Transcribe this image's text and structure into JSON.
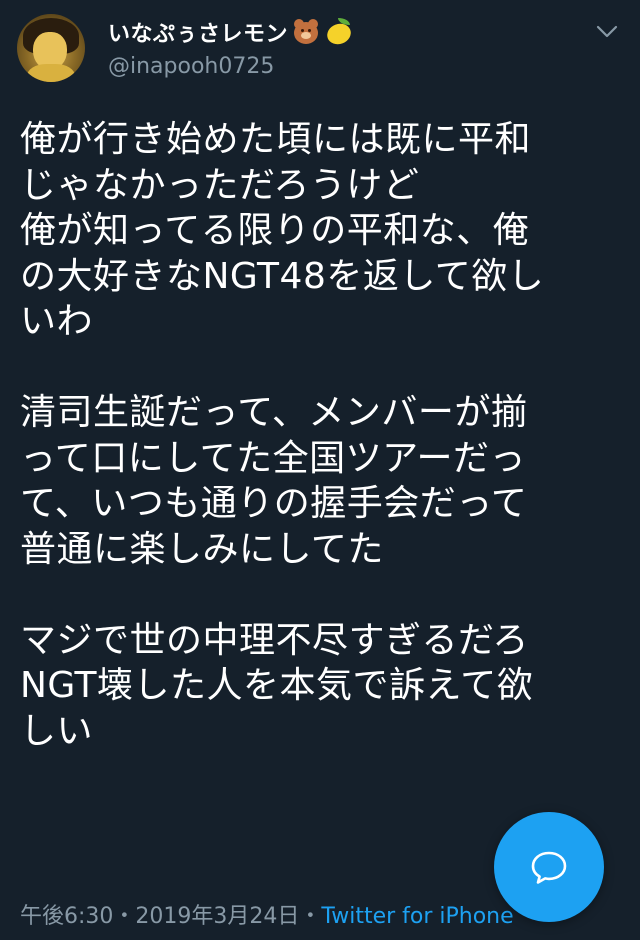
{
  "user": {
    "display_name": "いなぷぅさレモン",
    "name_emojis": [
      "bear-face",
      "lemon"
    ],
    "handle": "@inapooh0725"
  },
  "tweet": {
    "lines": [
      "俺が行き始めた頃には既に平和",
      "じゃなかっただろうけど",
      "俺が知ってる限りの平和な、俺",
      "の大好きなNGT48を返して欲し",
      "いわ",
      "",
      "清司生誕だって、メンバーが揃",
      "って口にしてた全国ツアーだっ",
      "て、いつも通りの握手会だって",
      "普通に楽しみにしてた",
      "",
      "マジで世の中理不尽すぎるだろ",
      "NGT壊した人を本気で訴えて欲",
      "しい"
    ]
  },
  "meta": {
    "time": "午後6:30",
    "separator": "・",
    "date": "2019年3月24日",
    "source": "Twitter for iPhone"
  },
  "icons": {
    "caret": "chevron-down-icon",
    "fab": "reply-bubble-icon"
  },
  "colors": {
    "background": "#15202b",
    "text": "#ffffff",
    "secondary": "#8899a6",
    "accent": "#1da1f2"
  }
}
